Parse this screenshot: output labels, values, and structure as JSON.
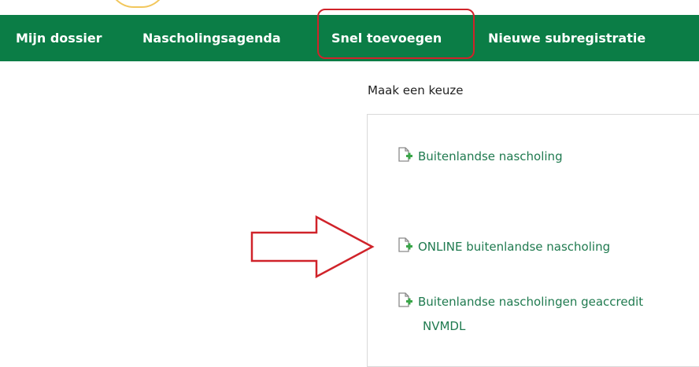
{
  "nav": {
    "items": [
      {
        "label": "Mijn dossier"
      },
      {
        "label": "Nascholingsagenda"
      },
      {
        "label": "Snel toevoegen"
      },
      {
        "label": "Nieuwe subregistratie"
      }
    ]
  },
  "main": {
    "prompt": "Maak een keuze",
    "options": [
      {
        "label": "Buitenlandse nascholing",
        "icon": "add-document-icon"
      },
      {
        "label": "ONLINE buitenlandse nascholing",
        "icon": "add-document-icon"
      },
      {
        "label": "Buitenlandse nascholingen geaccredit",
        "label_line2": "NVMDL",
        "icon": "add-document-icon"
      }
    ]
  },
  "colors": {
    "nav_bg": "#0b7d46",
    "link": "#1f7a4f",
    "annotation": "#d0232a"
  }
}
